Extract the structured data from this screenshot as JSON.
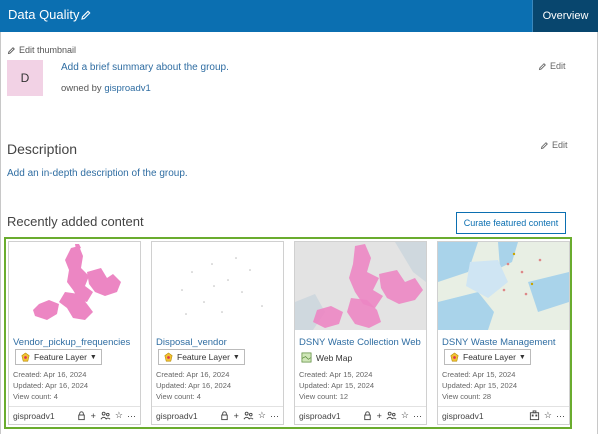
{
  "header": {
    "title": "Data Quality",
    "overview_label": "Overview",
    "brand_color": "#0b6fb1"
  },
  "thumbnail": {
    "edit_label": "Edit thumbnail",
    "letter": "D"
  },
  "summary": {
    "text": "Add a brief summary about the group.",
    "owned_prefix": "owned by",
    "owner": "gisproadv1",
    "edit_label": "Edit"
  },
  "description": {
    "heading": "Description",
    "text": "Add an in-depth description of the group.",
    "edit_label": "Edit"
  },
  "recent": {
    "heading": "Recently added content",
    "curate_label": "Curate featured content"
  },
  "cards": [
    {
      "name": "Vendor_pickup_frequencies",
      "type": "Feature Layer",
      "type_style": "dropdown",
      "created": "Created: Apr 16, 2024",
      "updated": "Updated: Apr 16, 2024",
      "views": "View count: 4",
      "owner": "gisproadv1",
      "thumb_icon": "pink-boroughs-map"
    },
    {
      "name": "Disposal_vendor",
      "type": "Feature Layer",
      "type_style": "dropdown",
      "created": "Created: Apr 16, 2024",
      "updated": "Updated: Apr 16, 2024",
      "views": "View count: 4",
      "owner": "gisproadv1",
      "thumb_icon": "sparse-points-map"
    },
    {
      "name": "DSNY Waste Collection Web …",
      "type": "Web Map",
      "type_style": "plain",
      "created": "Created: Apr 15, 2024",
      "updated": "Updated: Apr 15, 2024",
      "views": "View count: 12",
      "owner": "gisproadv1",
      "thumb_icon": "web-map-pink-overlay"
    },
    {
      "name": "DSNY Waste Management",
      "type": "Feature Layer",
      "type_style": "dropdown",
      "created": "Created: Apr 15, 2024",
      "updated": "Updated: Apr 15, 2024",
      "views": "View count: 28",
      "owner": "gisproadv1",
      "thumb_icon": "basemap-blue"
    }
  ]
}
